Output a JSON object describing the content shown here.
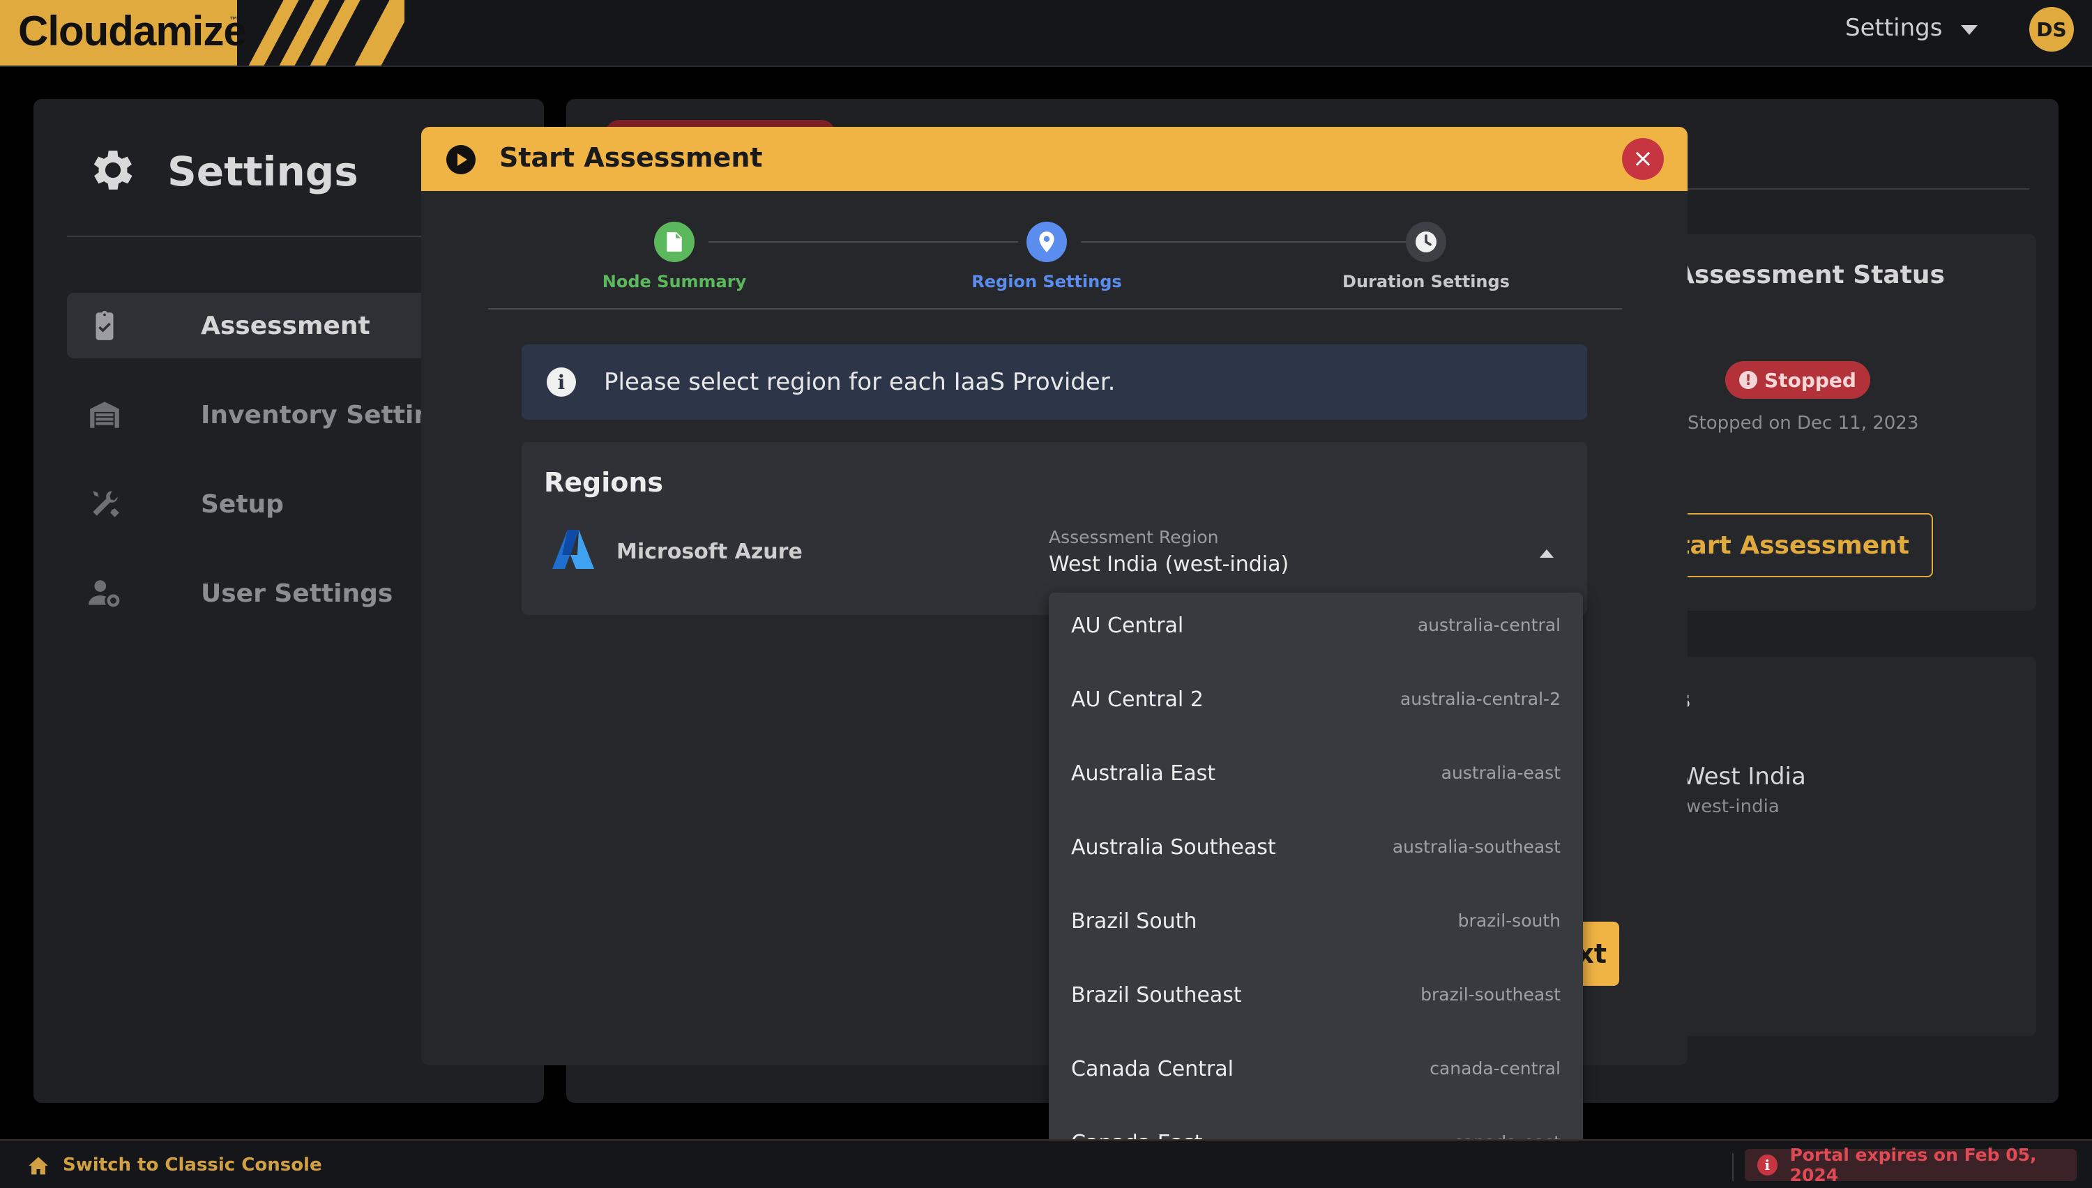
{
  "app": {
    "logo_text": "Cloudamize",
    "logo_tm": "™",
    "topbar_menu_label": "Settings",
    "avatar_initials": "DS",
    "brand_color": "#e0aa3e"
  },
  "sidebar": {
    "title": "Settings",
    "items": [
      {
        "label": "Assessment",
        "icon": "clipboard-check-icon",
        "active": true
      },
      {
        "label": "Inventory Settings",
        "icon": "warehouse-icon",
        "active": false
      },
      {
        "label": "Setup",
        "icon": "tools-icon",
        "active": false
      },
      {
        "label": "User Settings",
        "icon": "user-gear-icon",
        "active": false
      }
    ]
  },
  "background_panel": {
    "assessment_status_title": "Assessment Status",
    "status_badge": "Stopped",
    "stopped_on": "Stopped on Dec 11, 2023",
    "start_button": "Start Assessment",
    "card2_letter": "s",
    "region_name": "West India",
    "region_slug": "west-india"
  },
  "modal": {
    "title": "Start Assessment",
    "close_symbol": "×",
    "steps": [
      {
        "label": "Node Summary",
        "color": "#5cb85c",
        "icon": "document-icon"
      },
      {
        "label": "Region Settings",
        "color": "#5b8def",
        "icon": "map-pin-icon"
      },
      {
        "label": "Duration Settings",
        "color": "#c8c8c8",
        "icon": "clock-icon"
      }
    ],
    "info_text": "Please select region for each IaaS Provider.",
    "regions_title": "Regions",
    "provider_name": "Microsoft Azure",
    "assessment_region_label": "Assessment Region",
    "assessment_region_value": "West India (west-india)",
    "next_button": "xt"
  },
  "dropdown": {
    "options": [
      {
        "name": "AU Central",
        "slug": "australia-central"
      },
      {
        "name": "AU Central 2",
        "slug": "australia-central-2"
      },
      {
        "name": "Australia East",
        "slug": "australia-east"
      },
      {
        "name": "Australia Southeast",
        "slug": "australia-southeast"
      },
      {
        "name": "Brazil South",
        "slug": "brazil-south"
      },
      {
        "name": "Brazil Southeast",
        "slug": "brazil-southeast"
      },
      {
        "name": "Canada Central",
        "slug": "canada-central"
      },
      {
        "name": "Canada East",
        "slug": "canada-east"
      }
    ]
  },
  "footer": {
    "switch_label": "Switch to Classic Console",
    "expires_text": "Portal expires on Feb 05, 2024"
  }
}
